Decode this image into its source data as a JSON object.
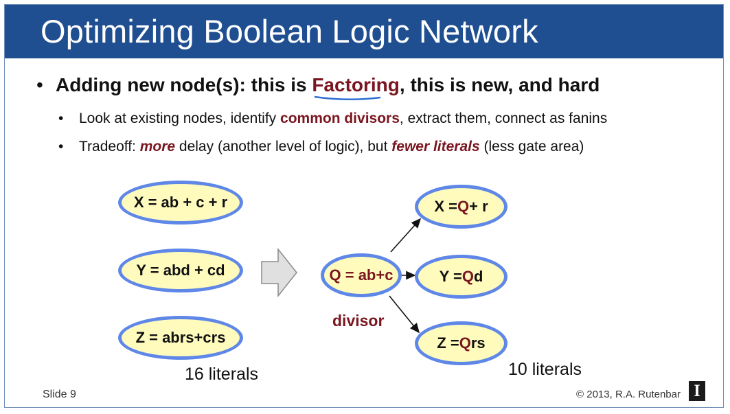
{
  "slide": {
    "title": "Optimizing Boolean Logic Network",
    "bullets": {
      "main": {
        "part1": "Adding new node(s): this is ",
        "highlight": "Factoring",
        "part2": ", this is new, and hard"
      },
      "sub1": {
        "part1": "Look at existing nodes, identify ",
        "highlight": "common divisors",
        "part2": ", extract them, connect as fanins"
      },
      "sub2": {
        "part1": "Tradeoff: ",
        "highlight1": "more",
        "part2": " delay (another level of logic), but ",
        "highlight2": "fewer literals",
        "part3": " (less gate area)"
      }
    },
    "bullet_char": "•",
    "diagram": {
      "before_nodes": [
        "X = ab + c + r",
        "Y = abd + cd",
        "Z = abrs+crs"
      ],
      "before_count": "16 literals",
      "divisor_node": "Q = ab+c",
      "divisor_label": "divisor",
      "after_nodes": [
        {
          "prefix": "X = ",
          "var": "Q",
          "suffix": " + r"
        },
        {
          "prefix": "Y = ",
          "var": "Q",
          "suffix": "d"
        },
        {
          "prefix": "Z = ",
          "var": "Q",
          "suffix": "rs"
        }
      ],
      "after_count": "10 literals"
    },
    "footer": {
      "slide_number": "Slide 9",
      "copyright": "© 2013, R.A. Rutenbar",
      "logo_letter": "I"
    },
    "colors": {
      "title_bar": "#1f4f91",
      "accent": "#7a1620",
      "node_fill": "#fffbbd",
      "node_border": "#5e87e8",
      "arrow_fill": "#e0e0e0"
    }
  }
}
